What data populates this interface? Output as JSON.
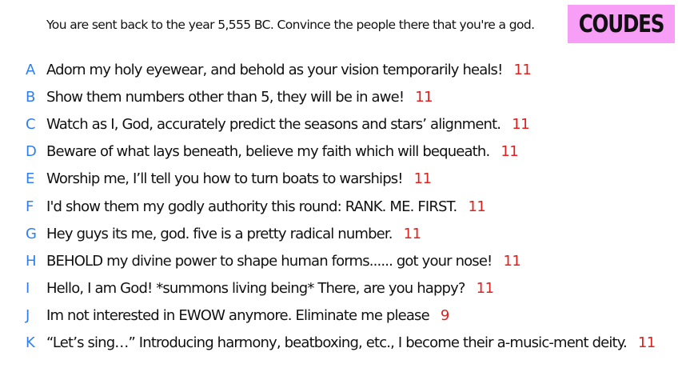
{
  "prompt": "You are sent back to the year 5,555 BC. Convince the people there that you're a god.",
  "logo": {
    "text": "COUDES",
    "background": "#f79ff7"
  },
  "colors": {
    "letter": "#2f7ff0",
    "score": "#e0201f",
    "text": "#111111"
  },
  "entries": [
    {
      "letter": "A",
      "text": "Adorn my holy eyewear, and behold as your vision temporarily heals!",
      "score": "11"
    },
    {
      "letter": "B",
      "text": "Show them numbers other than 5, they will be in awe!",
      "score": "11"
    },
    {
      "letter": "C",
      "text": "Watch as I, God, accurately predict the seasons and stars’ alignment.",
      "score": "11"
    },
    {
      "letter": "D",
      "text": "Beware of what lays beneath, believe my faith which will bequeath.",
      "score": "11"
    },
    {
      "letter": "E",
      "text": "Worship me, I’ll tell you how to turn boats to warships!",
      "score": "11"
    },
    {
      "letter": "F",
      "text": "I'd show them my godly authority this round: RANK. ME. FIRST.",
      "score": "11"
    },
    {
      "letter": "G",
      "text": "Hey guys its me, god. five is a pretty radical number.",
      "score": "11"
    },
    {
      "letter": "H",
      "text": "BEHOLD my divine power to shape human forms...... got your nose!",
      "score": "11"
    },
    {
      "letter": "I",
      "text": "Hello, I am God! *summons living being* There, are you happy?",
      "score": "11"
    },
    {
      "letter": "J",
      "text": "Im not interested in EWOW anymore. Eliminate me please",
      "score": "9"
    },
    {
      "letter": "K",
      "text": "“Let’s sing…” Introducing harmony, beatboxing, etc., I become their a-music-ment deity.",
      "score": "11"
    }
  ]
}
